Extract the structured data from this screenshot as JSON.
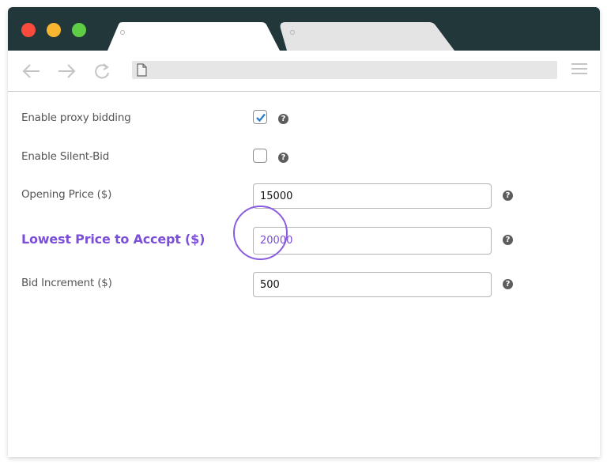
{
  "browser": {
    "window_controls": [
      "close",
      "minimize",
      "maximize"
    ],
    "tabs": [
      {
        "label": "",
        "active": true
      },
      {
        "label": "",
        "active": false
      }
    ],
    "address_bar": {
      "value": "",
      "icon": "document-icon"
    },
    "nav": {
      "back_icon": "arrow-left-icon",
      "forward_icon": "arrow-right-icon",
      "reload_icon": "reload-icon",
      "menu_icon": "hamburger-menu-icon"
    }
  },
  "form": {
    "proxy_bidding": {
      "label": "Enable proxy bidding",
      "checked": true,
      "help": "?"
    },
    "silent_bid": {
      "label": "Enable Silent-Bid",
      "checked": false,
      "help": "?"
    },
    "opening_price": {
      "label": "Opening Price ($)",
      "value": "15000",
      "help": "?"
    },
    "lowest_price": {
      "label": "Lowest Price to Accept ($)",
      "value": "20000",
      "help": "?"
    },
    "bid_increment": {
      "label": "Bid Increment ($)",
      "value": "500",
      "help": "?"
    }
  },
  "colors": {
    "titlebar": "#22373a",
    "highlight": "#7b4fd8",
    "checkmark": "#2f80c8",
    "close": "#fa4b3c",
    "minimize": "#f7b530",
    "maximize": "#5fcc45"
  }
}
